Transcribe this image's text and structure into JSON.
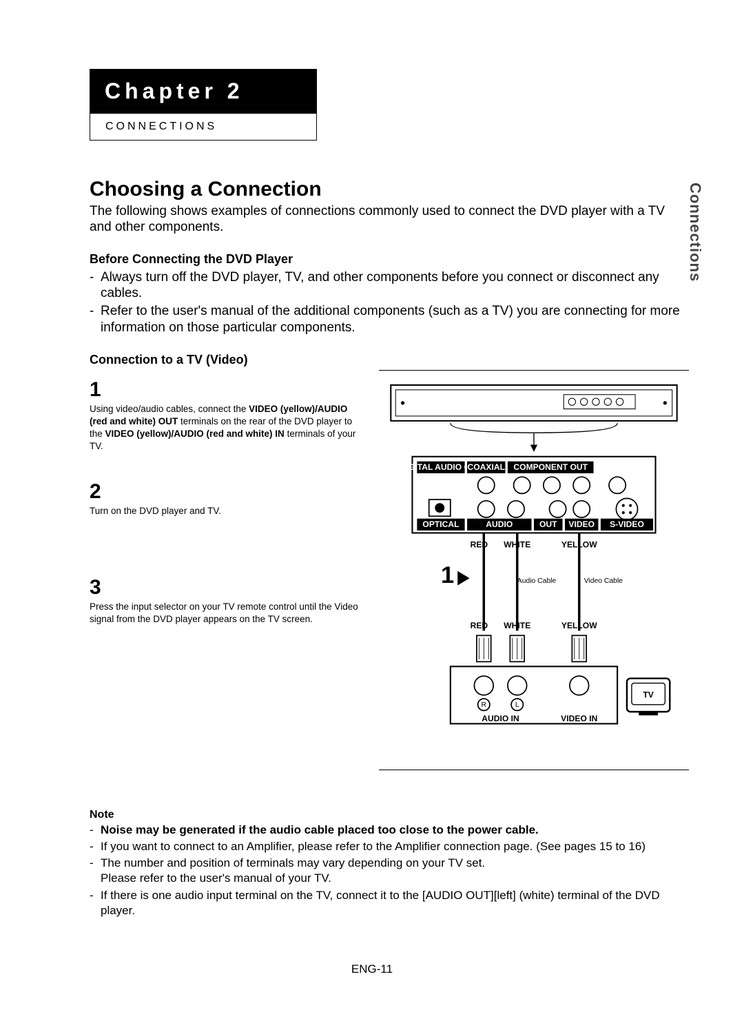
{
  "chapter": {
    "title": "Chapter 2",
    "subtitle": "CONNECTIONS"
  },
  "side_tab": "Connections",
  "section_title": "Choosing a Connection",
  "intro": "The following shows examples of connections commonly used to connect the DVD player with a TV and other components.",
  "before": {
    "heading": "Before Connecting the DVD Player",
    "items": [
      "Always turn off the DVD player, TV, and other components before you connect or disconnect any cables.",
      "Refer to the user's manual of the additional components (such as a TV) you are connecting for more information on those particular components."
    ]
  },
  "connection_heading": "Connection to a TV (Video)",
  "steps": [
    {
      "num": "1",
      "prefix": "Using video/audio cables, connect the ",
      "b1": "VIDEO (yellow)/AUDIO (red and white) OUT",
      "mid": " terminals on the rear of the DVD player to the ",
      "b2": "VIDEO (yellow)/AUDIO (red and white) IN",
      "suffix": " terminals of your TV."
    },
    {
      "num": "2",
      "text": "Turn on the DVD player and TV."
    },
    {
      "num": "3",
      "text": "Press the input selector on your TV remote control until the Video signal from the DVD player appears on the TV screen."
    }
  ],
  "diagram": {
    "panel": {
      "digital_audio_out": "DIGITAL AUDIO OUT",
      "coaxial": "COAXIAL",
      "component_out": "COMPONENT OUT",
      "optical": "OPTICAL",
      "audio": "AUDIO",
      "out": "OUT",
      "video": "VIDEO",
      "svideo": "S-VIDEO"
    },
    "colors_top": {
      "red": "RED",
      "white": "WHITE",
      "yellow": "YELLOW"
    },
    "step_arrow": "1",
    "cable_labels": {
      "audio": "Audio Cable",
      "video": "Video Cable"
    },
    "colors_bottom": {
      "red": "RED",
      "white": "WHITE",
      "yellow": "YELLOW"
    },
    "tv": "TV",
    "audio_in": "AUDIO IN",
    "video_in": "VIDEO IN",
    "lr": {
      "r": "R",
      "l": "L"
    }
  },
  "note": {
    "heading": "Note",
    "bold_line": "Noise may be generated if the audio cable placed too close to the power cable.",
    "lines": [
      "If you want to connect to an Amplifier, please refer to the Amplifier connection page. (See pages 15 to 16)",
      "The number and position of terminals may vary depending on your TV set.\nPlease refer to the user's manual of your TV.",
      "If there is one audio input terminal on the TV, connect it to the [AUDIO OUT][left] (white) terminal of the DVD player."
    ]
  },
  "page_number": "ENG-11"
}
